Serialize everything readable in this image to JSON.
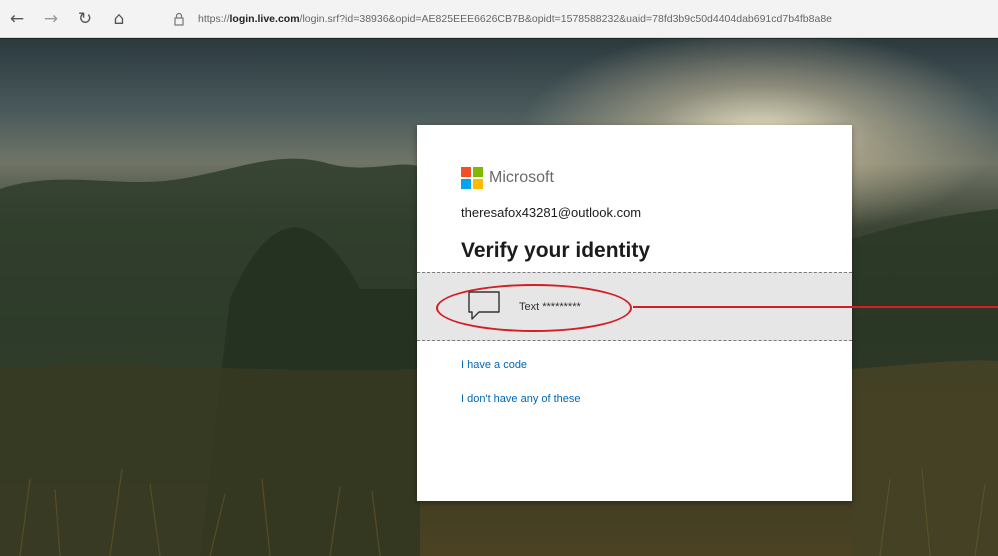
{
  "browser": {
    "back_icon": "arrow-left-icon",
    "forward_icon": "arrow-right-icon",
    "refresh_icon": "refresh-icon",
    "home_icon": "home-icon",
    "back_glyph": "←",
    "forward_glyph": "→",
    "refresh_glyph": "↻",
    "home_glyph": "⌂",
    "url_prefix": "https://",
    "url_host": "login.live.com",
    "url_path": "/login.srf?id=38936&opid=AE825EEE6626CB7B&opidt=1578588232&uaid=78fd3b9c50d4404dab691cd7b4fb8a8e"
  },
  "dialog": {
    "brand": "Microsoft",
    "brand_colors": [
      "#f25022",
      "#7fba00",
      "#00a4ef",
      "#ffb900"
    ],
    "email": "theresafox43281@outlook.com",
    "heading": "Verify your identity",
    "option": {
      "icon": "chat-bubble-icon",
      "label": "Text *********"
    },
    "links": {
      "have_code": "I have a code",
      "none": "I don't have any of these"
    }
  },
  "annotation": {
    "color": "#d21f26"
  }
}
